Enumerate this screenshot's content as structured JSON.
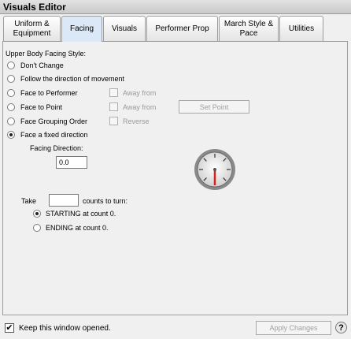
{
  "window": {
    "title": "Visuals Editor"
  },
  "tabs": [
    {
      "label": "Uniform & Equipment"
    },
    {
      "label": "Facing"
    },
    {
      "label": "Visuals"
    },
    {
      "label": "Performer Prop"
    },
    {
      "label": "March Style & Pace"
    },
    {
      "label": "Utilities"
    }
  ],
  "facing": {
    "section_label": "Upper Body Facing Style:",
    "options": [
      {
        "label": "Don't Change",
        "selected": false
      },
      {
        "label": "Follow the direction of movement",
        "selected": false
      },
      {
        "label": "Face to Performer",
        "selected": false
      },
      {
        "label": "Face to Point",
        "selected": false
      },
      {
        "label": "Face Grouping Order",
        "selected": false
      },
      {
        "label": "Face a fixed direction",
        "selected": true
      }
    ],
    "away_from_1": "Away from",
    "away_from_2": "Away from",
    "reverse": "Reverse",
    "set_point_button": "Set Point",
    "facing_direction_label": "Facing Direction:",
    "facing_direction_value": "0.0",
    "dial_angle_degrees": 0,
    "take_label": "Take",
    "take_value": "",
    "counts_label": "counts to turn:",
    "starting_label": "STARTING at count 0.",
    "ending_label": "ENDING at count 0.",
    "starting_selected": true
  },
  "footer": {
    "keep_open_label": "Keep this window opened.",
    "keep_open_checked": true,
    "apply_button": "Apply Changes",
    "help_glyph": "?"
  },
  "colors": {
    "accent_needle": "#d42020",
    "active_tab": "#dbe8f7"
  }
}
